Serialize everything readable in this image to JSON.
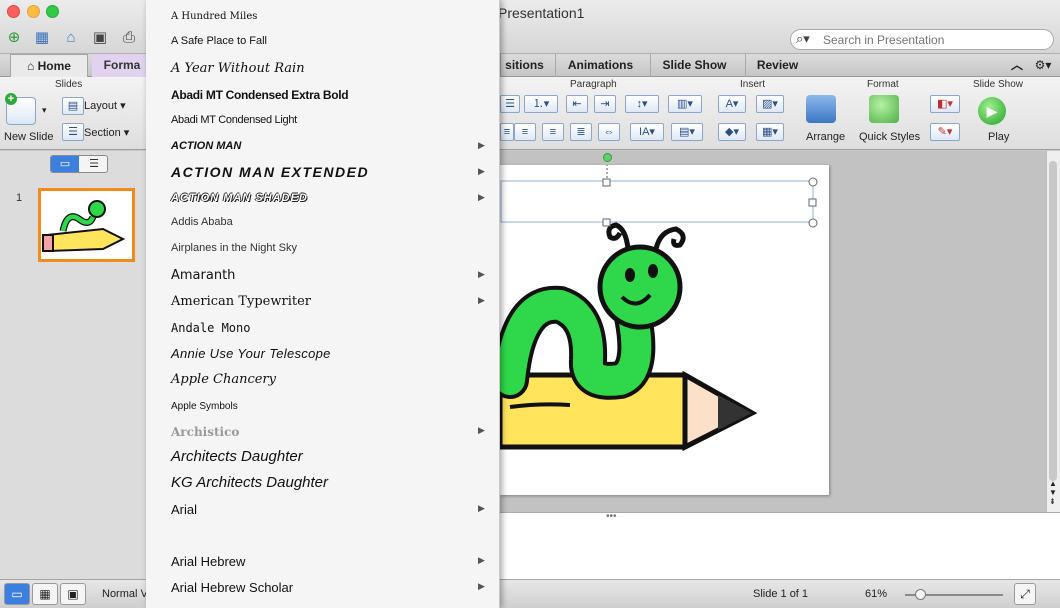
{
  "window": {
    "title": "Presentation1"
  },
  "search": {
    "placeholder": "Search in Presentation"
  },
  "ribbon_tabs": {
    "home": "Home",
    "format": "Forma",
    "transitions": "sitions",
    "animations": "Animations",
    "slideshow": "Slide Show",
    "review": "Review"
  },
  "ribbon": {
    "slides_group": "Slides",
    "new_slide": "New Slide",
    "layout": "Layout",
    "section": "Section",
    "paragraph_group": "Paragraph",
    "insert_group": "Insert",
    "format_group": "Format",
    "arrange": "Arrange",
    "quick_styles": "Quick Styles",
    "slideshow_group": "Slide Show",
    "play": "Play"
  },
  "slide_panel": {
    "slide_number": "1"
  },
  "font_menu": {
    "items": [
      {
        "name": "A Hundred Miles",
        "submenu": false
      },
      {
        "name": "A Safe Place to Fall",
        "submenu": false
      },
      {
        "name": "A Year Without Rain",
        "submenu": false
      },
      {
        "name": "Abadi MT Condensed Extra Bold",
        "submenu": false
      },
      {
        "name": "Abadi MT Condensed Light",
        "submenu": false
      },
      {
        "name": "ACTION MAN",
        "submenu": true
      },
      {
        "name": "ACTION MAN EXTENDED",
        "submenu": true
      },
      {
        "name": "ACTION MAN SHADED",
        "submenu": true
      },
      {
        "name": "Addis Ababa",
        "submenu": false
      },
      {
        "name": "Airplanes in the Night Sky",
        "submenu": false
      },
      {
        "name": "Amaranth",
        "submenu": true
      },
      {
        "name": "American Typewriter",
        "submenu": true
      },
      {
        "name": "Andale Mono",
        "submenu": false
      },
      {
        "name": "Annie Use Your Telescope",
        "submenu": false
      },
      {
        "name": "Apple Chancery",
        "submenu": false
      },
      {
        "name": "Apple Symbols",
        "submenu": false
      },
      {
        "name": "Archistico",
        "submenu": true
      },
      {
        "name": "Architects Daughter",
        "submenu": false
      },
      {
        "name": "KG Architects Daughter",
        "submenu": false
      },
      {
        "name": "Arial",
        "submenu": true
      },
      {
        "name": "Arial Hebrew",
        "submenu": true
      },
      {
        "name": "Arial Hebrew Scholar",
        "submenu": true
      }
    ]
  },
  "status": {
    "view": "Normal V",
    "slide_of": "Slide 1 of 1",
    "zoom": "61%"
  },
  "colors": {
    "accent_orange": "#f28a1c",
    "format_tab": "#e1d3f0",
    "worm_green": "#2fd84a",
    "pencil_yellow": "#ffe45c"
  }
}
